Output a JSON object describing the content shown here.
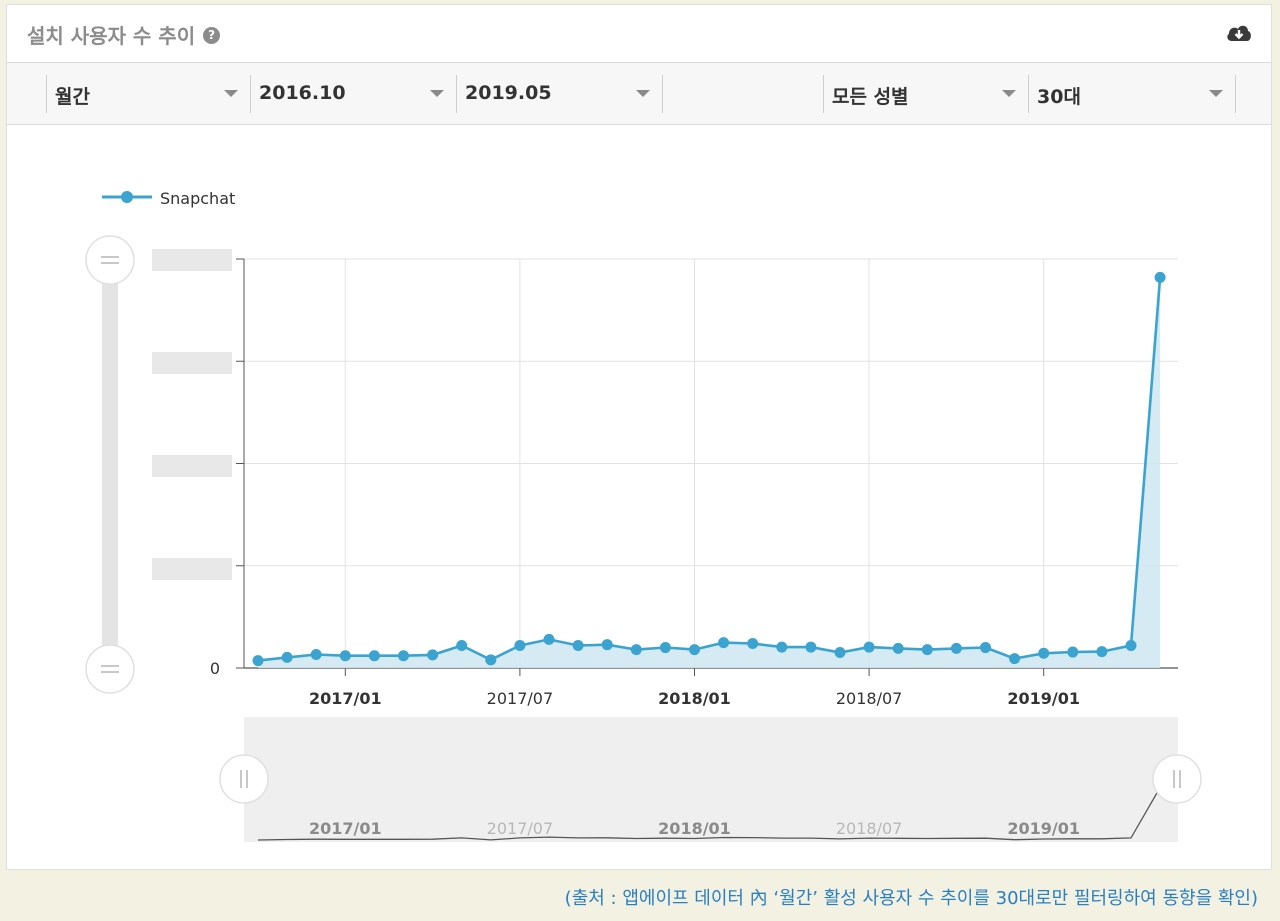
{
  "header": {
    "title": "설치 사용자 수 추이",
    "help_icon": "question-circle-icon",
    "download_icon": "cloud-download-icon"
  },
  "filters": [
    {
      "label": "월간"
    },
    {
      "label": "2016.10"
    },
    {
      "label": "2019.05"
    },
    {
      "label": "모든 성별"
    },
    {
      "label": "30대"
    }
  ],
  "caption": "(출처 : 앱에이프 데이터 內 ‘월간’ 활성 사용자 수 추이를 30대로만 필터링하여 동향을 확인)",
  "colors": {
    "accent": "#3aa3cf",
    "fill": "#cfe6f2",
    "caption": "#2a7fc0"
  },
  "chart_data": {
    "type": "area",
    "title": "",
    "series": [
      {
        "name": "Snapchat",
        "x": [
          "2016/10",
          "2016/11",
          "2016/12",
          "2017/01",
          "2017/02",
          "2017/03",
          "2017/04",
          "2017/05",
          "2017/06",
          "2017/07",
          "2017/08",
          "2017/09",
          "2017/10",
          "2017/11",
          "2017/12",
          "2018/01",
          "2018/02",
          "2018/03",
          "2018/04",
          "2018/05",
          "2018/06",
          "2018/07",
          "2018/08",
          "2018/09",
          "2018/10",
          "2018/11",
          "2018/12",
          "2019/01",
          "2019/02",
          "2019/03",
          "2019/04",
          "2019/05"
        ],
        "values": [
          1.8,
          2.6,
          3.3,
          3.0,
          3.0,
          3.0,
          3.2,
          5.5,
          2.0,
          5.5,
          7.0,
          5.5,
          5.7,
          4.5,
          5.0,
          4.5,
          6.2,
          6.0,
          5.1,
          5.1,
          3.8,
          5.1,
          4.8,
          4.5,
          4.8,
          5.0,
          2.3,
          3.6,
          3.9,
          4.0,
          5.5,
          95.5
        ]
      }
    ],
    "x_ticks": [
      {
        "label": "2017/01",
        "bold": true
      },
      {
        "label": "2017/07",
        "bold": false
      },
      {
        "label": "2018/01",
        "bold": true
      },
      {
        "label": "2018/07",
        "bold": false
      },
      {
        "label": "2019/01",
        "bold": true
      }
    ],
    "y_ticks": [
      "0"
    ],
    "ylim": [
      0,
      100
    ],
    "legend_position": "top-left",
    "grid": true
  }
}
